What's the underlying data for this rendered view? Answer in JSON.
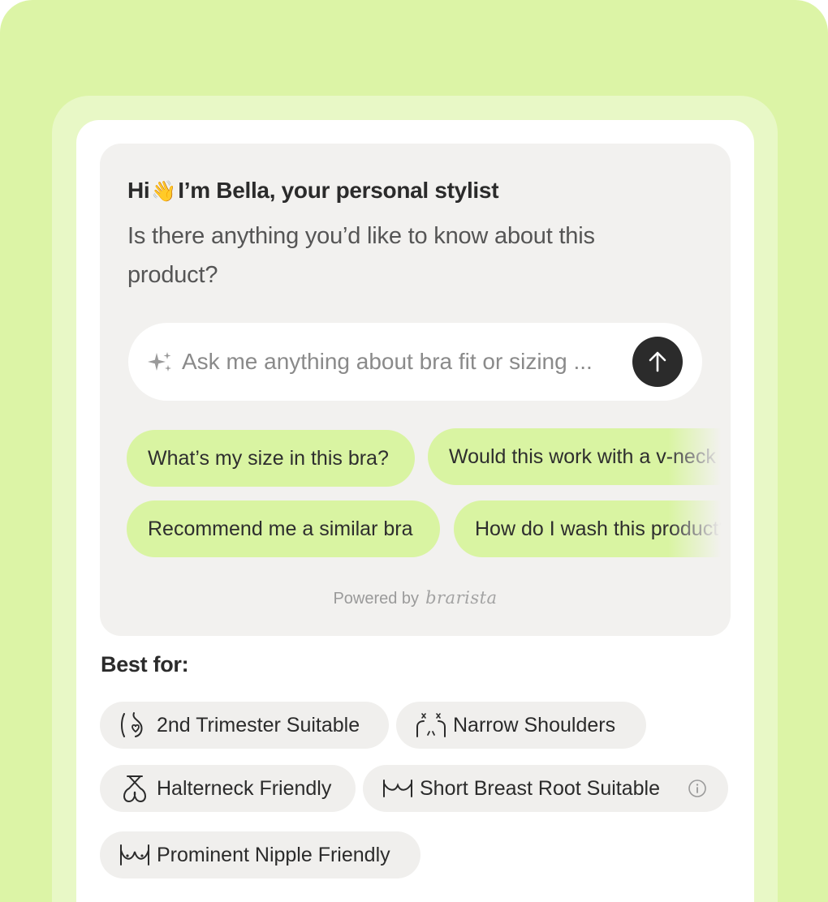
{
  "chat": {
    "greeting_prefix": "Hi",
    "wave_emoji": "👋",
    "greeting_rest": "I’m Bella, your personal stylist",
    "question": "Is there anything you’d like to know about this product?",
    "search": {
      "placeholder": "Ask me anything about bra fit or sizing ...",
      "icon": "sparkle-icon",
      "send_icon": "arrow-up-icon"
    },
    "suggestions": [
      "What’s my size in this bra?",
      "Would this work with a v-neck",
      "Recommend me a similar bra",
      "How do I wash this product?"
    ],
    "powered_by": "Powered by",
    "brand": "brarista"
  },
  "best_for": {
    "heading": "Best for:",
    "tags": [
      {
        "label": "2nd Trimester Suitable",
        "icon": "pregnancy-icon"
      },
      {
        "label": "Narrow Shoulders",
        "icon": "shoulders-icon"
      },
      {
        "label": "Halterneck Friendly",
        "icon": "halterneck-icon"
      },
      {
        "label": "Short Breast Root Suitable",
        "icon": "breast-root-icon",
        "info_icon": "info-icon"
      },
      {
        "label": "Prominent Nipple Friendly",
        "icon": "nipple-icon"
      }
    ]
  },
  "colors": {
    "background": "#dcf4a6",
    "chip": "#d9f4a2",
    "panel": "#f2f1ef",
    "send_button": "#2b2b2b"
  }
}
